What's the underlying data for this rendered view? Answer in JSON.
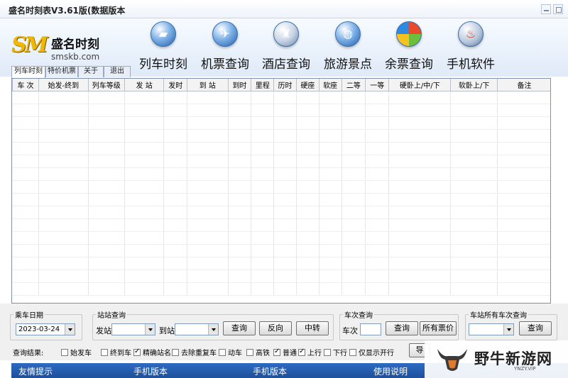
{
  "window": {
    "title": "盛名时刻表V3.61版(数据版本"
  },
  "logo": {
    "mark": "SM",
    "name": "盛名时刻",
    "url": "smskb.com"
  },
  "nav": [
    {
      "label": "列车时刻",
      "icon": "train-icon"
    },
    {
      "label": "机票查询",
      "icon": "airplane-icon"
    },
    {
      "label": "酒店查询",
      "icon": "hotel-icon"
    },
    {
      "label": "旅游景点",
      "icon": "globe-icon"
    },
    {
      "label": "余票查询",
      "icon": "windows-icon"
    },
    {
      "label": "手机软件",
      "icon": "java-icon"
    }
  ],
  "tabs": [
    "列车时刻",
    "特价机票",
    "关于",
    "退出"
  ],
  "table": {
    "columns": [
      "车 次",
      "始发-终到",
      "列车等级",
      "发  站",
      "发时",
      "到  站",
      "到时",
      "里程",
      "历时",
      "硬座",
      "软座",
      "二等",
      "一等",
      "硬卧上/中/下",
      "软卧上/下",
      "备注"
    ]
  },
  "ride_date": {
    "legend": "乘车日期",
    "value": "2023-03-24"
  },
  "station_query": {
    "legend": "站站查询",
    "from_label": "发站",
    "to_label": "到站",
    "query": "查询",
    "reverse": "反向",
    "transfer": "中转"
  },
  "train_query": {
    "legend": "车次查询",
    "train_label": "车次",
    "query": "查询",
    "all_fares": "所有票价"
  },
  "station_trains": {
    "legend": "车站所有车次查询",
    "query": "查询"
  },
  "results": {
    "label": "查询结果:",
    "options": [
      {
        "label": "始发车",
        "checked": false
      },
      {
        "label": "终到车",
        "checked": false
      },
      {
        "label": "精确站名",
        "checked": true
      },
      {
        "label": "去除重复车",
        "checked": false
      },
      {
        "label": "动车",
        "checked": false
      },
      {
        "label": "高铁",
        "checked": false
      },
      {
        "label": "普通",
        "checked": true
      },
      {
        "label": "上行",
        "checked": true
      },
      {
        "label": "下行",
        "checked": false
      },
      {
        "label": "仅显示开行",
        "checked": false
      }
    ],
    "export_button": "导"
  },
  "status": [
    "友情提示",
    "手机版本",
    "手机版本",
    "使用说明"
  ],
  "watermark": {
    "name": "野牛新游网",
    "url": "YNZY.VIP"
  },
  "colors": {
    "status_bar": "#2d6bc2",
    "logo": "#f0b800",
    "header": "#dfeaf8"
  }
}
